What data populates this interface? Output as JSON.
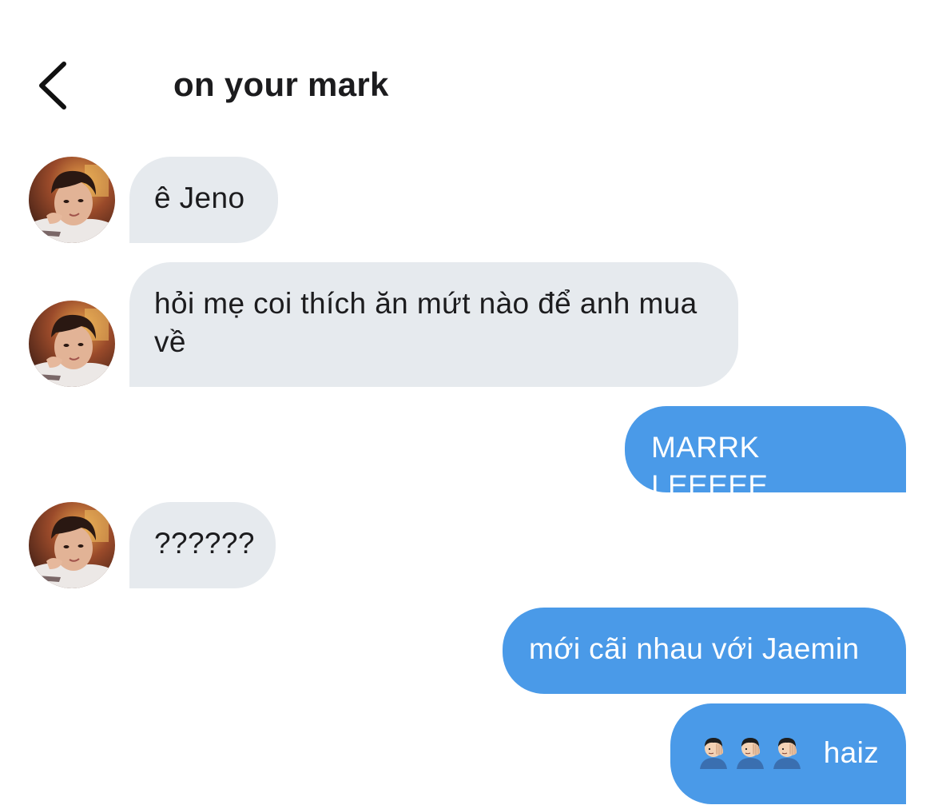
{
  "header": {
    "title": "on your mark",
    "back_icon": "chevron-left-icon"
  },
  "messages": [
    {
      "sender": "them",
      "text": "ê Jeno",
      "avatar": true
    },
    {
      "sender": "them",
      "text": "hỏi mẹ coi thích ăn mứt nào để anh mua về",
      "avatar": true
    },
    {
      "sender": "me",
      "text": "MARRK LEEEEE"
    },
    {
      "sender": "them",
      "text": "??????",
      "avatar": true
    },
    {
      "sender": "me",
      "text": "mới cãi nhau với Jaemin"
    },
    {
      "sender": "me",
      "text": "haiz",
      "emoji_prefix": [
        "facepalm-icon",
        "facepalm-icon",
        "facepalm-icon"
      ]
    }
  ],
  "colors": {
    "incoming_bubble": "#e6eaee",
    "outgoing_bubble": "#4a9ae8",
    "outgoing_text": "#ffffff",
    "incoming_text": "#1c1c1e"
  }
}
